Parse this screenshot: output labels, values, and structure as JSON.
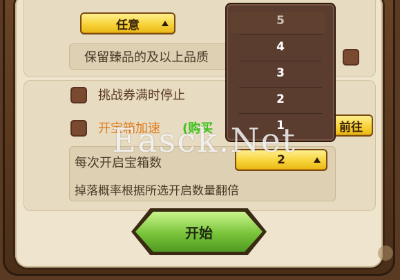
{
  "quality": {
    "dropdown_value": "任意",
    "keep_label": "保留臻品的及以上品质"
  },
  "ticket": {
    "stop_label": "挑战券满时停止"
  },
  "chest": {
    "accel_label": "开宝箱加速",
    "accel_note": "(购买",
    "go_button": "前往",
    "count_label": "每次开启宝箱数",
    "count_value": "2",
    "count_note": "掉落概率根据所选开启数量翻倍"
  },
  "dropdown_options": [
    "5",
    "4",
    "3",
    "2",
    "1"
  ],
  "start_button": "开始",
  "watermark": "Easck.Net",
  "colors": {
    "accent_yellow": "#f7d338",
    "start_green": "#79c43a",
    "accel_orange": "#e07b1a",
    "note_green": "#3ec21f"
  }
}
